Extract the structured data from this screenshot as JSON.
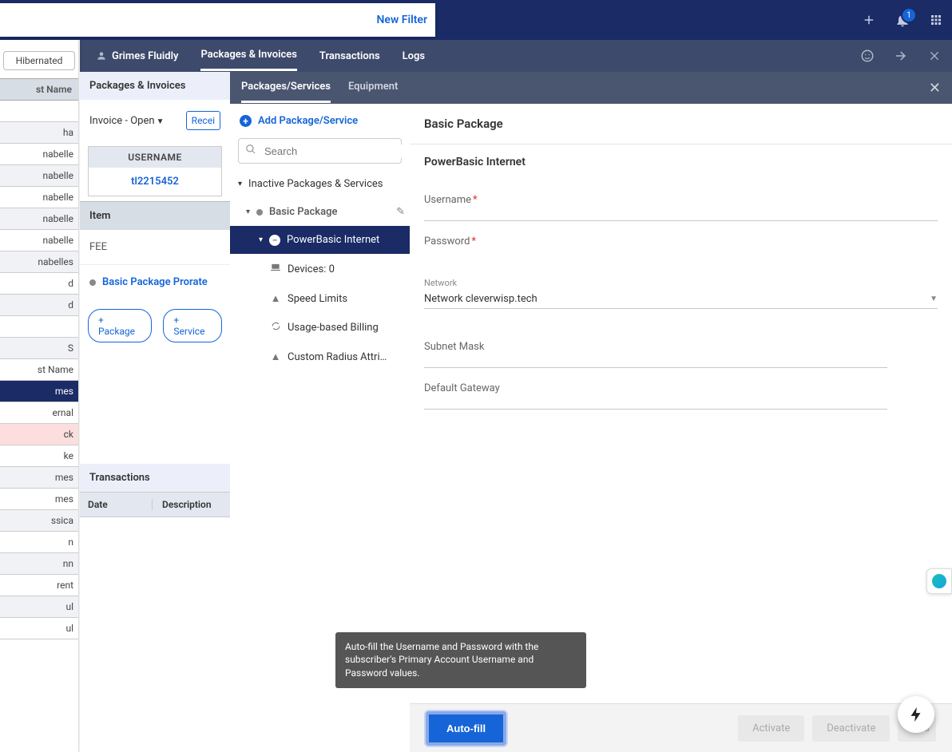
{
  "topbar": {
    "new_filter": "New Filter",
    "notification_count": "1"
  },
  "subheader": {
    "user": "Grimes Fluidly",
    "tabs": [
      "Packages & Invoices",
      "Transactions",
      "Logs"
    ],
    "active_tab": "Packages & Invoices"
  },
  "left_list": {
    "status_pill": "Hibernated",
    "column_header": "st Name",
    "rows": [
      "",
      "ha",
      "nabelle",
      "nabelle",
      "nabelle",
      "nabelle",
      "nabelle",
      "nabelles",
      "d",
      "d",
      "",
      "S",
      "st Name",
      "mes",
      "ernal",
      "ck",
      "ke",
      "mes",
      "mes",
      "ssica",
      "n",
      "nn",
      "rent",
      "ul",
      "ul"
    ],
    "selected_index": 13,
    "pink_index": 15
  },
  "mid": {
    "panel_title": "Packages & Invoices",
    "invoice_dropdown": "Invoice - Open",
    "receipt_btn": "Recei",
    "username_label": "USERNAME",
    "username_value": "tl2215452",
    "item_header": "Item",
    "fee_row": "FEE",
    "prorate_label": "Basic Package Prorate",
    "add_package_btn": "+ Package",
    "add_service_btn": "+ Service",
    "transactions_title": "Transactions",
    "trans_col_date": "Date",
    "trans_col_desc": "Description"
  },
  "tree": {
    "tabs": [
      "Packages/Services",
      "Equipment"
    ],
    "active_tab": "Packages/Services",
    "add_label": "Add Package/Service",
    "search_placeholder": "Search",
    "group_label": "Inactive Packages & Services",
    "basic_package": "Basic Package",
    "powerbasic": "PowerBasic Internet",
    "leaf_devices": "Devices: 0",
    "leaf_speed": "Speed Limits",
    "leaf_usage": "Usage-based Billing",
    "leaf_radius": "Custom Radius Attri…"
  },
  "form": {
    "title": "Basic Package",
    "subtitle": "PowerBasic Internet",
    "username_label": "Username",
    "password_label": "Password",
    "network_mini_label": "Network",
    "network_value": "Network cleverwisp.tech",
    "subnet_label": "Subnet Mask",
    "gateway_label": "Default Gateway"
  },
  "tooltip": {
    "text": "Auto-fill the Username and Password with the subscriber's Primary Account Username and Password values."
  },
  "footer": {
    "autofill": "Auto-fill",
    "activate": "Activate",
    "deactivate": "Deactivate",
    "reset": "Res"
  }
}
